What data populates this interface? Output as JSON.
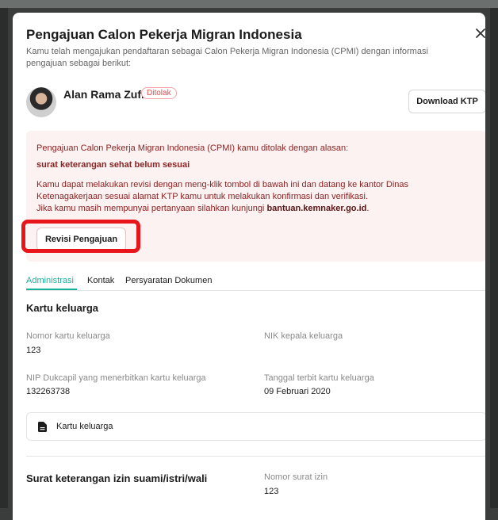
{
  "modal": {
    "title": "Pengajuan Calon Pekerja Migran Indonesia",
    "subtitle": "Kamu telah mengajukan pendaftaran sebagai Calon Pekerja Migran Indonesia (CPMI) dengan informasi pengajuan sebagai berikut:"
  },
  "user": {
    "name": "Alan Rama Zufri",
    "status": "Ditolak",
    "download_label": "Download KTP"
  },
  "alert": {
    "line1": "Pengajuan Calon Pekerja Migran Indonesia (CPMI) kamu ditolak dengan alasan:",
    "reason": "surat keterangan sehat belum sesuai",
    "line3": "Kamu dapat melakukan revisi dengan meng-klik tombol di bawah ini dan datang ke kantor Dinas",
    "line4": "Ketenagakerjaan sesuai alamat KTP kamu untuk melakukan konfirmasi dan verifikasi.",
    "line5_prefix": "Jika kamu masih mempunyai pertanyaan silahkan kunjungi ",
    "line5_link": "bantuan.kemnaker.go.id",
    "line5_suffix": ".",
    "revise_label": "Revisi Pengajuan"
  },
  "tabs": [
    "Administrasi",
    "Kontak",
    "Persyaratan Dokumen"
  ],
  "kartu_keluarga": {
    "title": "Kartu keluarga",
    "nomor_label": "Nomor kartu keluarga",
    "nomor_value": "123",
    "nik_label": "NIK kepala keluarga",
    "nip_label": "NIP Dukcapil yang menerbitkan kartu keluarga",
    "nip_value": "132263738",
    "tanggal_label": "Tanggal terbit kartu keluarga",
    "tanggal_value": "09 Februari 2020",
    "file_label": "Kartu keluarga"
  },
  "izin": {
    "title": "Surat keterangan izin suami/istri/wali",
    "nomor_label": "Nomor surat izin",
    "nomor_value": "123"
  },
  "colors": {
    "accent": "#14b09a",
    "danger": "#e5484d",
    "highlight": "#e8151b"
  }
}
